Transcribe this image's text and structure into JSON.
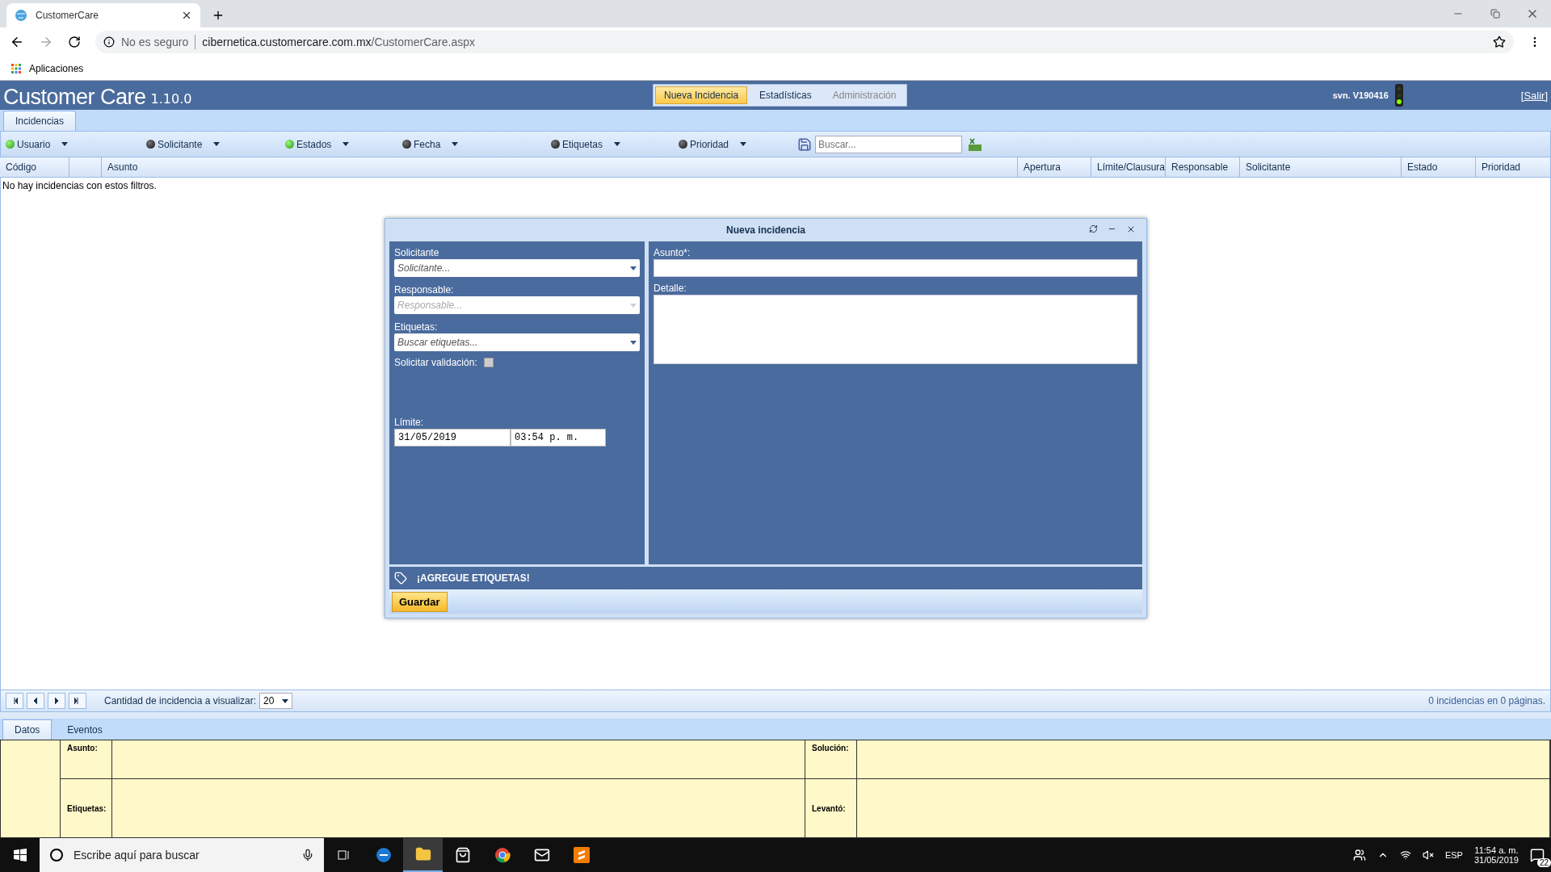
{
  "browser": {
    "tab_title": "CustomerCare",
    "not_secure": "No es seguro",
    "url_host": "cibernetica.customercare.com.mx",
    "url_path": "/CustomerCare.aspx",
    "bookmark": "Aplicaciones"
  },
  "app": {
    "logo": "Customer Care",
    "version": "1.10.0",
    "nav": [
      {
        "label": "Nueva Incidencia",
        "selected": true,
        "disabled": false
      },
      {
        "label": "Estadísticas",
        "selected": false,
        "disabled": false
      },
      {
        "label": "Administración",
        "selected": false,
        "disabled": true
      }
    ],
    "svn": "svn. V190416",
    "logout": "[Salir]"
  },
  "main_tabs": [
    {
      "label": "Incidencias",
      "selected": true
    }
  ],
  "filters": [
    {
      "label": "Usuario",
      "on": true
    },
    {
      "label": "Solicitante",
      "on": false
    },
    {
      "label": "Estados",
      "on": true
    },
    {
      "label": "Fecha",
      "on": false
    },
    {
      "label": "Etiquetas",
      "on": false
    },
    {
      "label": "Prioridad",
      "on": false
    }
  ],
  "search": {
    "placeholder": "Buscar..."
  },
  "table": {
    "columns": [
      "Código",
      "Asunto",
      "Apertura",
      "Límite/Clausura",
      "Responsable",
      "Solicitante",
      "Estado",
      "Prioridad"
    ],
    "empty_message": "No hay incidencias con estos filtros."
  },
  "modal": {
    "title": "Nueva incidencia",
    "fields": [
      {
        "label": "Solicitante",
        "placeholder": "Solicitante...",
        "disabled": false
      },
      {
        "label": "Responsable:",
        "placeholder": "Responsable...",
        "disabled": true
      },
      {
        "label": "Etiquetas:",
        "placeholder": "Buscar etiquetas...",
        "disabled": false
      }
    ],
    "validation": {
      "label": "Solicitar validación:",
      "checked": false
    },
    "limit": {
      "label": "Límite:",
      "date": "31/05/2019",
      "time": "03:54 p. m."
    },
    "subject_label": "Asunto*:",
    "detail_label": "Detalle:",
    "tags_banner": "¡AGREGUE ETIQUETAS!",
    "save_button": "Guardar"
  },
  "pager": {
    "label": "Cantidad de incidencia a visualizar:",
    "page_size": "20",
    "summary": "0 incidencias en 0 páginas."
  },
  "detail_tabs": [
    {
      "label": "Datos",
      "selected": true
    },
    {
      "label": "Eventos",
      "selected": false
    }
  ],
  "detail_labels": [
    "Asunto:",
    "Solución:",
    "Etiquetas:",
    "Levantó:"
  ],
  "taskbar": {
    "search_placeholder": "Escribe aquí para buscar",
    "language": "ESP",
    "time": "11:54 a. m.",
    "date": "31/05/2019",
    "notifications": "22"
  }
}
